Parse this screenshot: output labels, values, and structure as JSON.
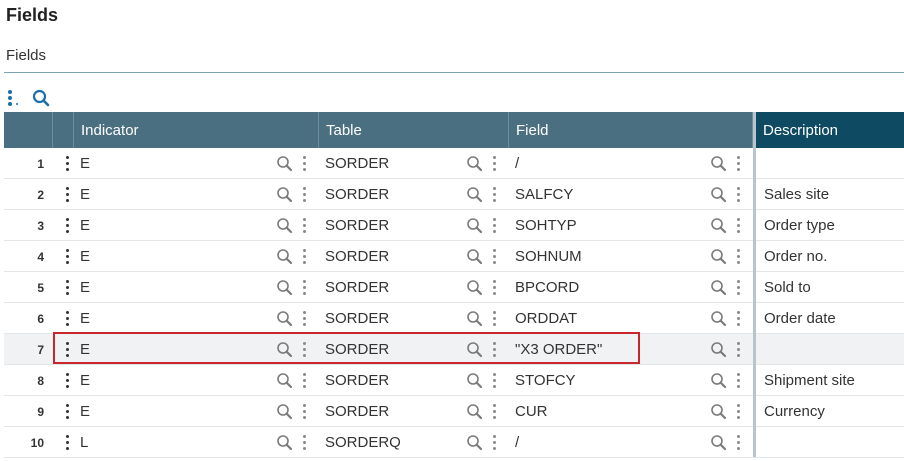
{
  "page": {
    "title": "Fields",
    "section_title": "Fields"
  },
  "toolbar": {
    "actions_icon": "vertical-dots-icon",
    "search_icon": "search-icon"
  },
  "grid": {
    "columns": [
      {
        "key": "indicator",
        "label": "Indicator"
      },
      {
        "key": "table",
        "label": "Table"
      },
      {
        "key": "field",
        "label": "Field"
      },
      {
        "key": "description",
        "label": "Description"
      }
    ],
    "rows": [
      {
        "num": "1",
        "indicator": "E",
        "table": "SORDER",
        "field": "/",
        "description": ""
      },
      {
        "num": "2",
        "indicator": "E",
        "table": "SORDER",
        "field": "SALFCY",
        "description": "Sales site"
      },
      {
        "num": "3",
        "indicator": "E",
        "table": "SORDER",
        "field": "SOHTYP",
        "description": "Order type"
      },
      {
        "num": "4",
        "indicator": "E",
        "table": "SORDER",
        "field": "SOHNUM",
        "description": "Order no."
      },
      {
        "num": "5",
        "indicator": "E",
        "table": "SORDER",
        "field": "BPCORD",
        "description": "Sold to"
      },
      {
        "num": "6",
        "indicator": "E",
        "table": "SORDER",
        "field": "ORDDAT",
        "description": "Order date"
      },
      {
        "num": "7",
        "indicator": "E",
        "table": "SORDER",
        "field": "\"X3 ORDER\"",
        "description": ""
      },
      {
        "num": "8",
        "indicator": "E",
        "table": "SORDER",
        "field": "STOFCY",
        "description": "Shipment site"
      },
      {
        "num": "9",
        "indicator": "E",
        "table": "SORDER",
        "field": "CUR",
        "description": "Currency"
      },
      {
        "num": "10",
        "indicator": "L",
        "table": "SORDERQ",
        "field": "/",
        "description": ""
      }
    ],
    "selected_row": "7",
    "colors": {
      "header": "#4a6f80",
      "description_header": "#0e4b63",
      "highlight": "#c8282d",
      "accent": "#1a6fa8"
    }
  }
}
